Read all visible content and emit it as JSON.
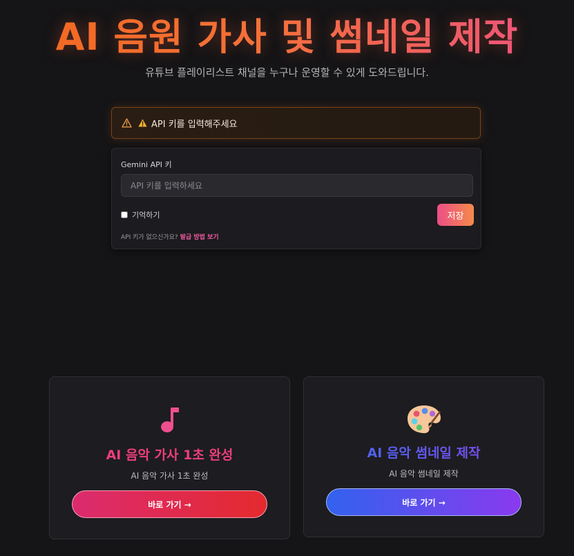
{
  "header": {
    "title": "AI 음원 가사 및 썸네일 제작",
    "subtitle": "유튜브 플레이리스트 채널을 누구나 운영할 수 있게 도와드립니다."
  },
  "alert": {
    "message": "API 키를 입력해주세요",
    "icon": "warning-icon"
  },
  "api_panel": {
    "label": "Gemini API 키",
    "input_value": "",
    "input_placeholder": "API 키를 입력하세요",
    "remember_label": "기억하기",
    "remember_checked": false,
    "save_label": "저장",
    "hint_text": "API 키가 없으신가요?",
    "hint_link": "발급 방법 보기"
  },
  "cards": [
    {
      "icon": "music-note-icon",
      "title": "AI 음악 가사 1초 완성",
      "description": "AI 음악 가사 1초 완성",
      "button_label": "바로 가기 →",
      "accent": "#ec3f79"
    },
    {
      "icon": "palette-icon",
      "title": "AI 음악 썸네일 제작",
      "description": "AI 음악 썸네일 제작",
      "button_label": "바로 가기 →",
      "accent": "#5a5cf0"
    }
  ],
  "colors": {
    "background": "#151416",
    "title_gradient_start": "#f26a1b",
    "title_gradient_end": "#ee4f8e",
    "warning": "#e8a317"
  }
}
